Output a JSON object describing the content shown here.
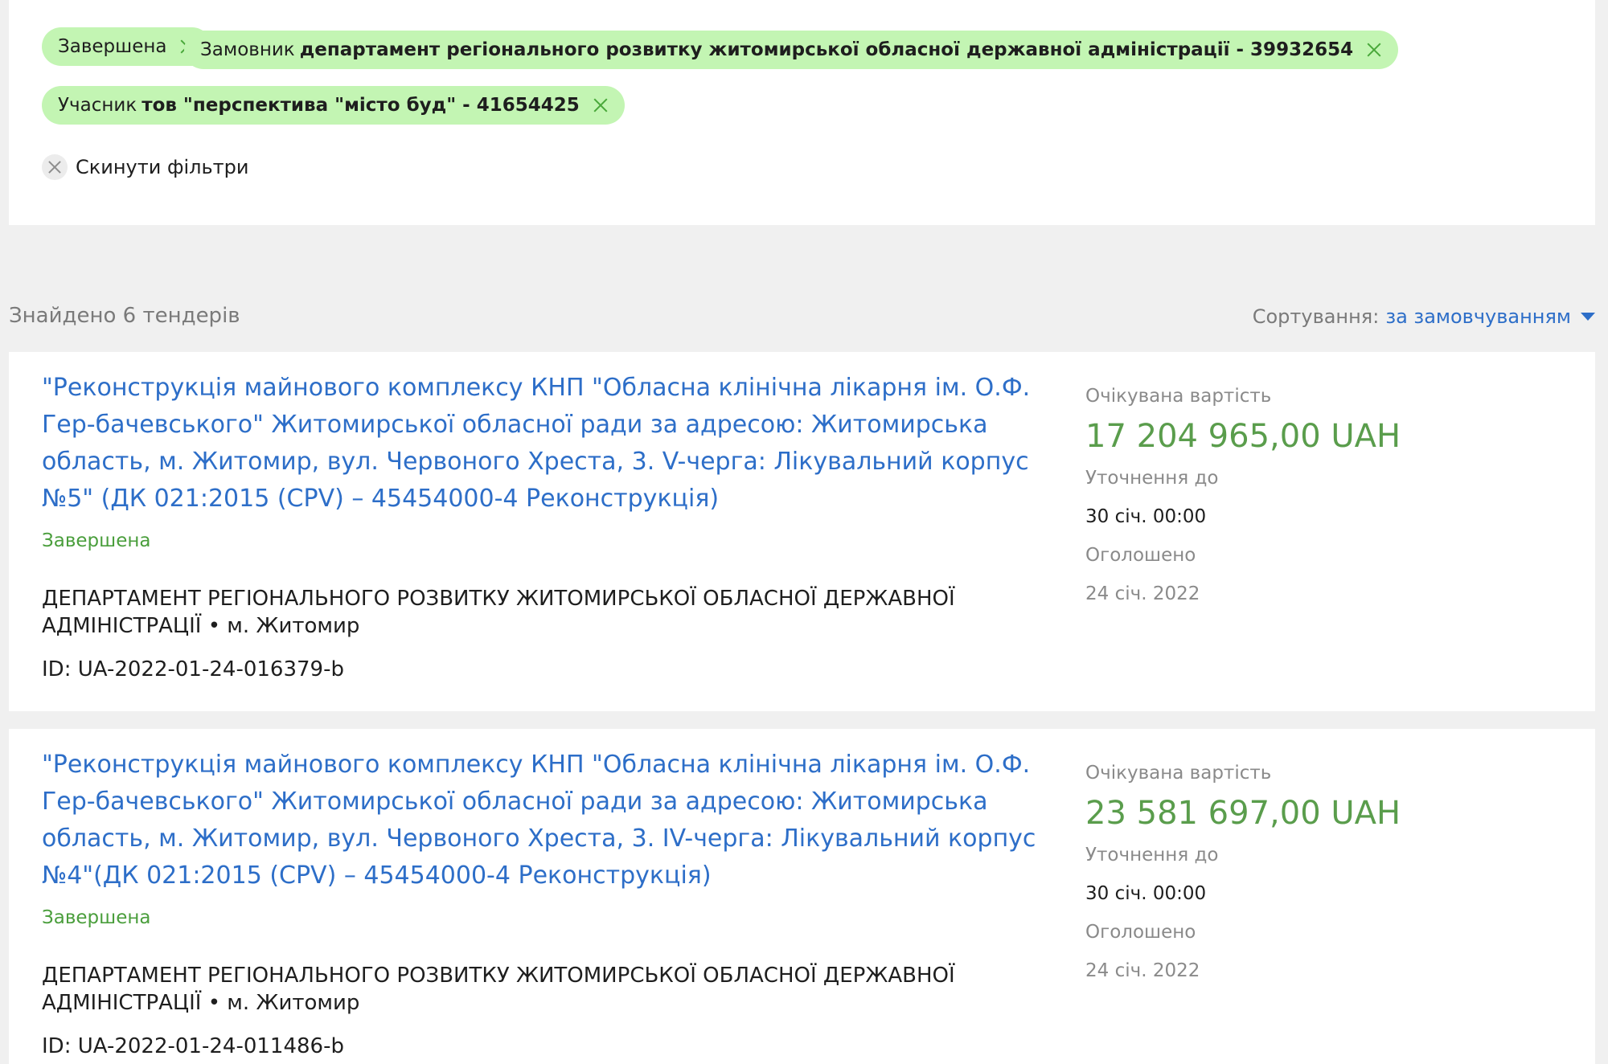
{
  "filters": {
    "chips": [
      {
        "label": "Завершена",
        "value": ""
      },
      {
        "label": "Замовник",
        "value": "департамент регіонального розвитку житомирської обласної державної адміністрації - 39932654"
      },
      {
        "label": "Учасник",
        "value": "тов \"перспектива \"місто буд\" - 41654425"
      }
    ],
    "reset_label": "Скинути фільтри"
  },
  "results": {
    "found_text": "Знайдено 6 тендерів",
    "sort_label": "Сортування:",
    "sort_value": "за замовчуванням"
  },
  "tenders": [
    {
      "title": "\"Реконструкція майнового комплексу КНП \"Обласна клінічна лікарня ім. О.Ф. Гер-бачевського\" Житомирської обласної ради за адресою: Житомирська область, м. Житомир, вул. Червоного Хреста, 3. V-черга: Лікувальний корпус №5\" (ДК 021:2015 (CPV) – 45454000-4 Реконструкція)",
      "status": "Завершена",
      "buyer": "ДЕПАРТАМЕНТ РЕГІОНАЛЬНОГО РОЗВИТКУ ЖИТОМИРСЬКОЇ ОБЛАСНОЇ ДЕРЖАВНОЇ АДМІНІСТРАЦІЇ • м. Житомир",
      "id": "ID: UA-2022-01-24-016379-b",
      "expected_label": "Очікувана вартість",
      "amount": "17 204 965,00 UAH",
      "clarify_label": "Уточнення до",
      "clarify_value": "30 січ. 00:00",
      "announced_label": "Оголошено",
      "announced_value": "24 січ. 2022"
    },
    {
      "title": "\"Реконструкція майнового комплексу КНП \"Обласна клінічна лікарня ім. О.Ф. Гер-бачевського\" Житомирської обласної ради за адресою: Житомирська область, м. Житомир, вул. Червоного Хреста, 3. IV-черга: Лікувальний корпус №4\"(ДК 021:2015 (CPV) – 45454000-4 Реконструкція)",
      "status": "Завершена",
      "buyer": "ДЕПАРТАМЕНТ РЕГІОНАЛЬНОГО РОЗВИТКУ ЖИТОМИРСЬКОЇ ОБЛАСНОЇ ДЕРЖАВНОЇ АДМІНІСТРАЦІЇ • м. Житомир",
      "id": "ID: UA-2022-01-24-011486-b",
      "expected_label": "Очікувана вартість",
      "amount": "23 581 697,00 UAH",
      "clarify_label": "Уточнення до",
      "clarify_value": "30 січ. 00:00",
      "announced_label": "Оголошено",
      "announced_value": "24 січ. 2022"
    }
  ],
  "colors": {
    "chip_bg": "#c3f5b3",
    "link": "#2d6ec8",
    "status_green": "#4a9e3c",
    "amount_green": "#5a9d4c"
  }
}
